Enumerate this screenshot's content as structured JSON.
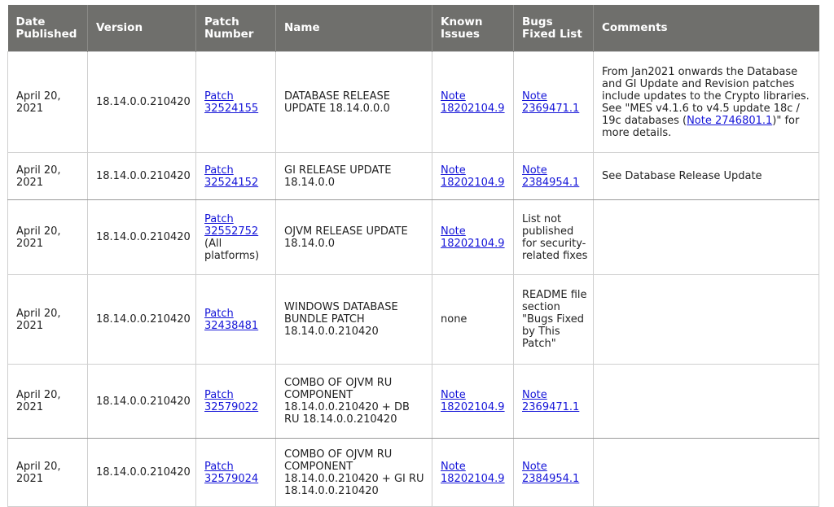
{
  "table": {
    "headers": [
      "Date Published",
      "Version",
      "Patch Number",
      "Name",
      "Known Issues",
      "Bugs Fixed List",
      "Comments"
    ],
    "rows": [
      {
        "date": "April 20, 2021",
        "version": "18.14.0.0.210420",
        "patch": "Patch 32524155",
        "patch_extra": "",
        "name": "DATABASE RELEASE UPDATE 18.14.0.0.0",
        "known": "Note 18202104.9",
        "known_link": true,
        "bugs": "Note 2369471.1",
        "bugs_link": true,
        "comment_pre": "From Jan2021 onwards the Database and GI Update and Revision patches include updates to the Crypto libraries. See \"MES v4.1.6 to v4.5 update 18c / 19c databases (",
        "comment_link": "Note 2746801.1",
        "comment_post": ")\" for more details."
      },
      {
        "date": "April 20, 2021",
        "version": "18.14.0.0.210420",
        "patch": "Patch 32524152",
        "patch_extra": "",
        "name": "GI RELEASE UPDATE 18.14.0.0",
        "known": "Note 18202104.9",
        "known_link": true,
        "bugs": "Note 2384954.1",
        "bugs_link": true,
        "comment_pre": "See Database Release Update",
        "comment_link": "",
        "comment_post": ""
      },
      {
        "date": "April 20, 2021",
        "version": "18.14.0.0.210420",
        "patch": "Patch 32552752",
        "patch_extra": "(All platforms)",
        "name": "OJVM RELEASE UPDATE 18.14.0.0",
        "known": "Note 18202104.9",
        "known_link": true,
        "bugs": "List not published for security-related fixes",
        "bugs_link": false,
        "comment_pre": "",
        "comment_link": "",
        "comment_post": ""
      },
      {
        "date": "April 20, 2021",
        "version": "18.14.0.0.210420",
        "patch": "Patch 32438481",
        "patch_extra": "",
        "name": "WINDOWS DATABASE BUNDLE PATCH 18.14.0.0.210420",
        "known": "none",
        "known_link": false,
        "bugs": "README file section \"Bugs Fixed by This Patch\"",
        "bugs_link": false,
        "comment_pre": "",
        "comment_link": "",
        "comment_post": ""
      },
      {
        "date": "April 20, 2021",
        "version": "18.14.0.0.210420",
        "patch": "Patch 32579022",
        "patch_extra": "",
        "name": "COMBO OF OJVM RU COMPONENT 18.14.0.0.210420 + DB RU 18.14.0.0.210420",
        "known": "Note 18202104.9",
        "known_link": true,
        "bugs": "Note 2369471.1",
        "bugs_link": true,
        "comment_pre": "",
        "comment_link": "",
        "comment_post": ""
      },
      {
        "date": "April 20, 2021",
        "version": "18.14.0.0.210420",
        "patch": "Patch 32579024",
        "patch_extra": "",
        "name": "COMBO OF OJVM RU COMPONENT 18.14.0.0.210420 + GI RU 18.14.0.0.210420",
        "known": "Note 18202104.9",
        "known_link": true,
        "bugs": "Note 2384954.1",
        "bugs_link": true,
        "comment_pre": "",
        "comment_link": "",
        "comment_post": ""
      }
    ]
  }
}
